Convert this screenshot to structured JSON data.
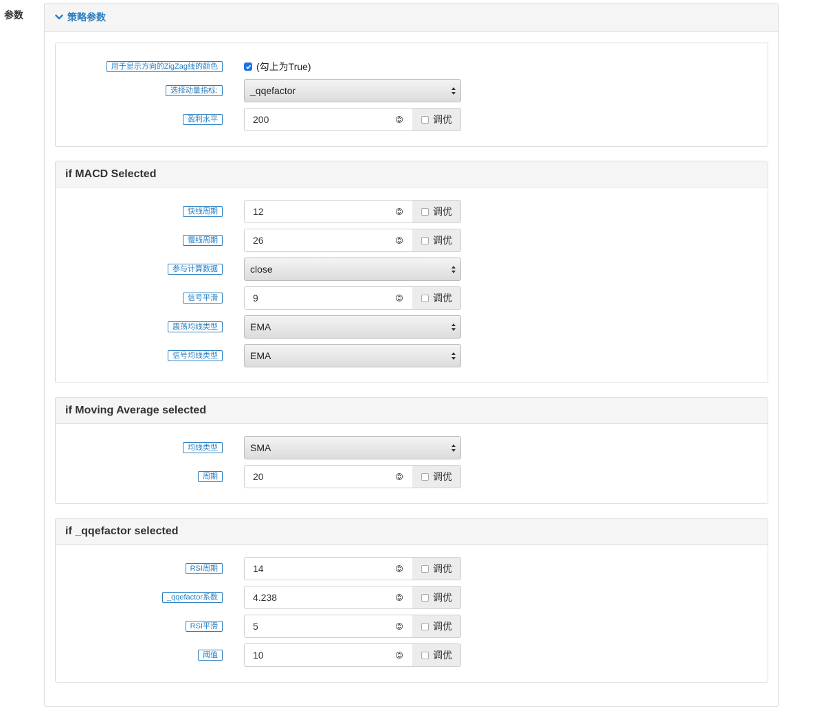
{
  "page": {
    "label": "参数"
  },
  "section": {
    "title": "策略参数"
  },
  "general": {
    "zigzag_color": {
      "label": "用于显示方向的ZigZag线的颜色",
      "checkbox_text": "(勾上为True)"
    },
    "momentum": {
      "label": "选择动量指标:",
      "value": "_qqefactor"
    },
    "profit": {
      "label": "盈利水平",
      "value": "200",
      "tune": "调优"
    }
  },
  "macd": {
    "title": "if MACD Selected",
    "fast": {
      "label": "快线周期",
      "value": "12",
      "tune": "调优"
    },
    "slow": {
      "label": "慢线周期",
      "value": "26",
      "tune": "调优"
    },
    "source": {
      "label": "参与计算数据",
      "value": "close"
    },
    "signal": {
      "label": "信号平滑",
      "value": "9",
      "tune": "调优"
    },
    "osc_ma": {
      "label": "震荡均线类型",
      "value": "EMA"
    },
    "signal_ma": {
      "label": "信号均线类型",
      "value": "EMA"
    }
  },
  "ma": {
    "title": "if Moving Average selected",
    "type": {
      "label": "均线类型",
      "value": "SMA"
    },
    "period": {
      "label": "周期",
      "value": "20",
      "tune": "调优"
    }
  },
  "qqe": {
    "title": "if _qqefactor selected",
    "rsi_period": {
      "label": "RSI周期",
      "value": "14",
      "tune": "调优"
    },
    "factor": {
      "label": "_qqefactor系数",
      "value": "4.238",
      "tune": "调优"
    },
    "rsi_smooth": {
      "label": "RSI平滑",
      "value": "5",
      "tune": "调优"
    },
    "threshold": {
      "label": "阈值",
      "value": "10",
      "tune": "调优"
    }
  }
}
